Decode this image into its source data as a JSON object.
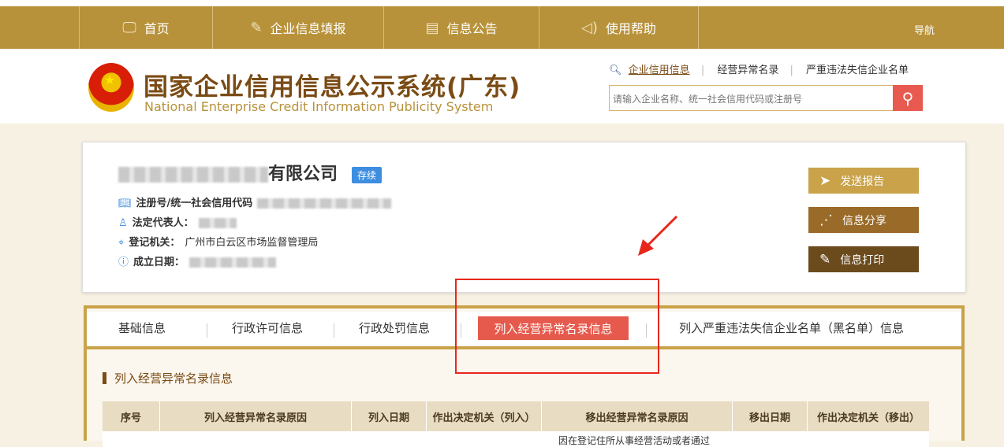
{
  "nav": {
    "items": [
      {
        "label": "首页",
        "icon": "monitor-icon"
      },
      {
        "label": "企业信息填报",
        "icon": "edit-icon"
      },
      {
        "label": "信息公告",
        "icon": "document-icon"
      },
      {
        "label": "使用帮助",
        "icon": "speaker-icon"
      }
    ],
    "guide": "导航"
  },
  "header": {
    "title_cn": "国家企业信用信息公示系统(广东)",
    "title_en": "National Enterprise Credit Information Publicity System",
    "links": [
      "企业信用信息",
      "经营异常名录",
      "严重违法失信企业名单"
    ],
    "search_placeholder": "请输入企业名称、统一社会信用代码或注册号"
  },
  "company": {
    "name_suffix": "有限公司",
    "status": "存续",
    "reg_label": "注册号/统一社会信用代码",
    "legal_label": "法定代表人：",
    "authority_label": "登记机关：",
    "authority_value": "广州市白云区市场监督管理局",
    "date_label": "成立日期："
  },
  "actions": {
    "send": "发送报告",
    "share": "信息分享",
    "print": "信息打印"
  },
  "tabs": [
    "基础信息",
    "行政许可信息",
    "行政处罚信息",
    "列入经营异常名录信息",
    "列入严重违法失信企业名单（黑名单）信息"
  ],
  "section": {
    "title": "列入经营异常名录信息",
    "columns": [
      "序号",
      "列入经营异常名录原因",
      "列入日期",
      "作出决定机关（列入）",
      "移出经营异常名录原因",
      "移出日期",
      "作出决定机关（移出）"
    ],
    "row_partial_text": "因在登记住所从事经营活动或者通过"
  },
  "colors": {
    "gold": "#b8923a",
    "accent_red": "#e65a4e",
    "blue": "#3d8ee0"
  }
}
